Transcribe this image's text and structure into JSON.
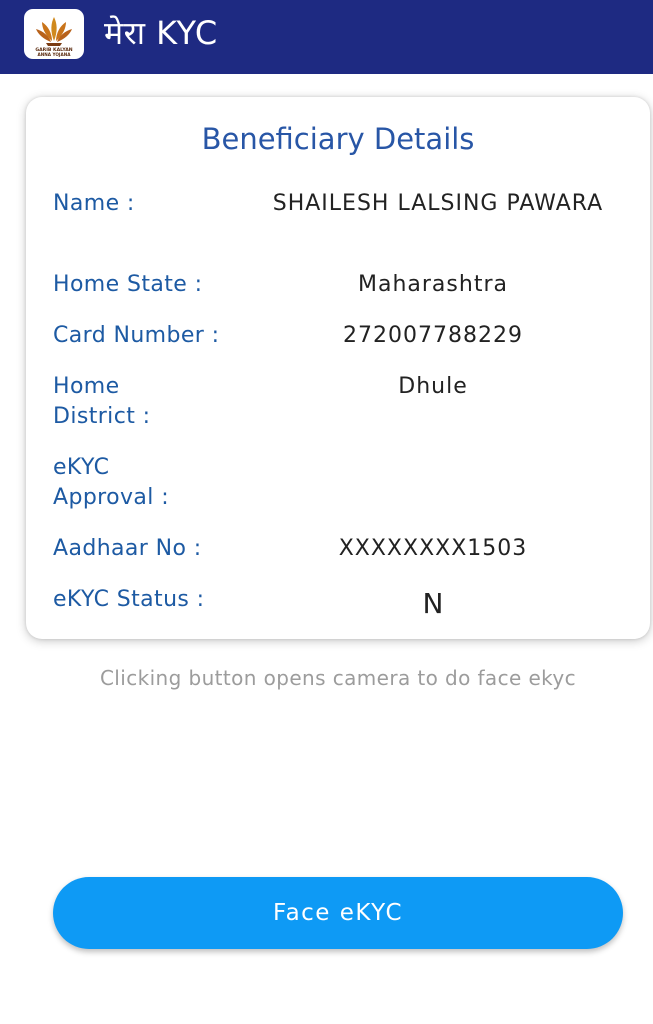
{
  "app_bar": {
    "title": "मेरा KYC",
    "logo_caption_line1": "GARIB KALYAN",
    "logo_caption_line2": "ANNA YOJANA",
    "background_color": "#1e2a82"
  },
  "card": {
    "title": "Beneficiary Details",
    "fields": [
      {
        "label": "Name :",
        "value": "SHAILESH LALSING PAWARA"
      },
      {
        "label": "Home State :",
        "value": "Maharashtra"
      },
      {
        "label": "Card Number :",
        "value": "272007788229"
      },
      {
        "label": "Home District :",
        "value": "Dhule"
      },
      {
        "label": "eKYC Approval :",
        "value": ""
      },
      {
        "label": "Aadhaar No :",
        "value": "XXXXXXXX1503"
      },
      {
        "label": "eKYC Status :",
        "value": "N"
      }
    ],
    "label_color": "#1d5aa3",
    "title_color": "#2856a6"
  },
  "hint": "Clicking button opens camera to do face ekyc",
  "face_ekyc_button": {
    "label": "Face eKYC",
    "color": "#0e9af5"
  }
}
